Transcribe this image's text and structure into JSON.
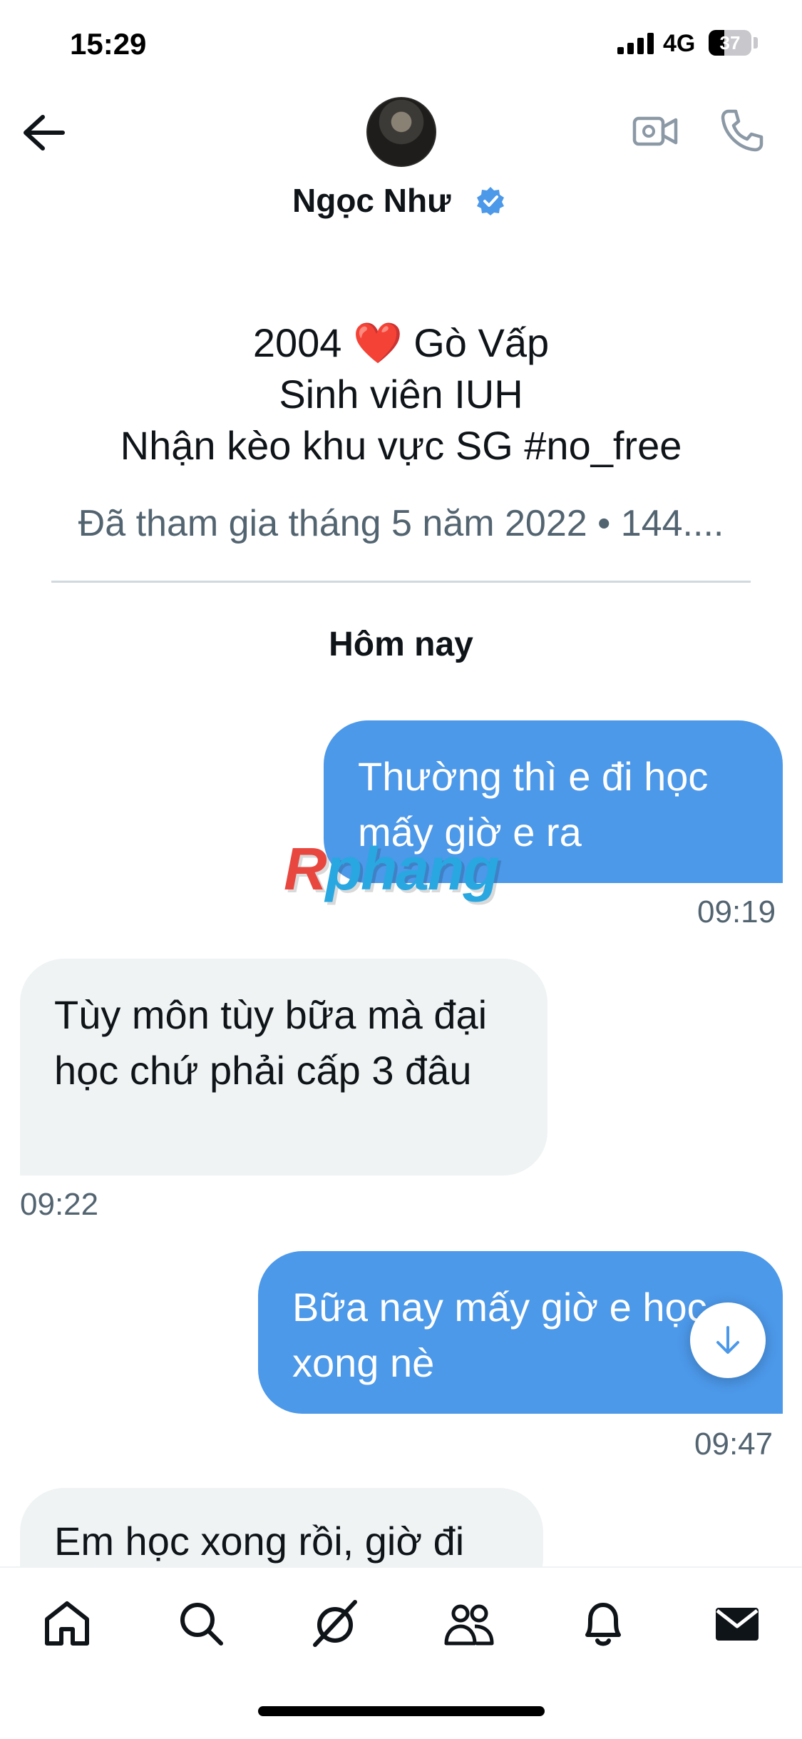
{
  "status": {
    "time": "15:29",
    "network": "4G",
    "battery": "37"
  },
  "header": {
    "name": "Ngọc Như"
  },
  "bio": {
    "line1": "2004 ❤️ Gò Vấp",
    "line2": "Sinh viên IUH",
    "line3": "Nhận kèo khu vực SG  #no_free",
    "meta": "Đã tham gia tháng 5 năm 2022 • 144...."
  },
  "day_label": "Hôm nay",
  "messages": [
    {
      "side": "out",
      "text": "Thường thì e đi học mấy giờ e ra",
      "time": "09:19"
    },
    {
      "side": "in",
      "text": "Tùy môn tùy bữa mà đại học chứ phải cấp 3 đâu",
      "time": "09:22"
    },
    {
      "side": "out",
      "text": "Bữa nay mấy giờ e học xong nè",
      "time": "09:47"
    },
    {
      "side": "in",
      "text": "Em học xong rồi, giờ đi",
      "time": ""
    }
  ],
  "watermark": {
    "part1": "R",
    "part2": "phang"
  },
  "nav": {
    "items": [
      "home-icon",
      "search-icon",
      "grok-icon",
      "communities-icon",
      "notifications-icon",
      "messages-icon"
    ]
  },
  "colors": {
    "bubble_out": "#4c98e9",
    "bubble_in": "#eff3f4",
    "verified": "#4c98e9"
  }
}
